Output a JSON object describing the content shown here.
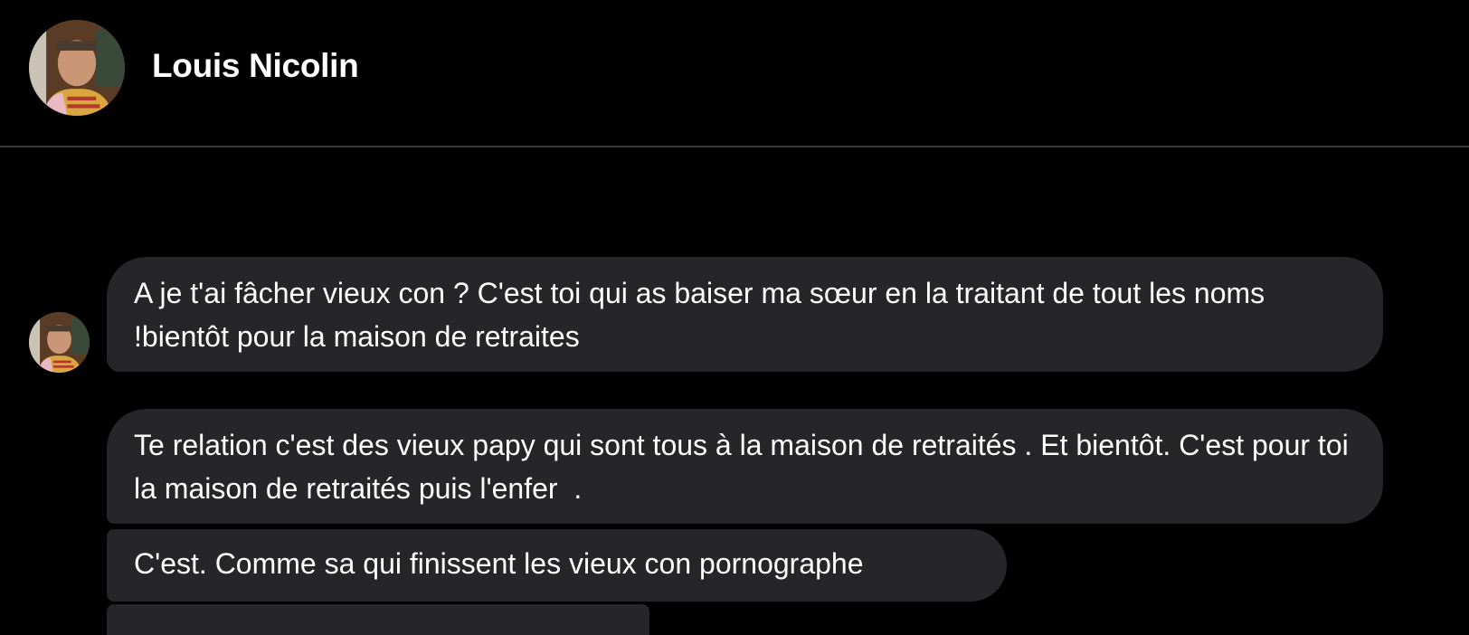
{
  "header": {
    "contact_name": "Louis Nicolin",
    "avatar_icon": "profile-photo-icon"
  },
  "messages": [
    {
      "sender": "Louis Nicolin",
      "text": "A je t'ai fâcher vieux con ? C'est toi qui as baiser ma sœur en la traitant de tout les noms !bientôt pour la maison de retraites"
    },
    {
      "sender": "Louis Nicolin",
      "text": "Te relation c'est des vieux papy qui sont tous à la maison de retraités . Et bientôt. C'est pour toi la maison de retraités puis l'enfer  ."
    },
    {
      "sender": "Louis Nicolin",
      "text": "C'est. Comme sa qui finissent les vieux con pornographe"
    }
  ],
  "colors": {
    "background": "#000000",
    "bubble": "#262628",
    "divider": "#3a3a3c",
    "text": "#ffffff"
  }
}
